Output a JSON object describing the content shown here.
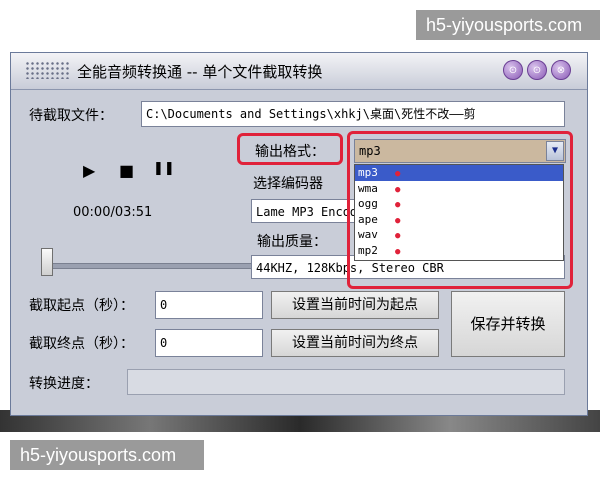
{
  "watermark": {
    "top": "h5-yiyousports.com",
    "bottom": "h5-yiyousports.com"
  },
  "window": {
    "title": "全能音频转换通 -- 单个文件截取转换",
    "title_buttons": [
      "⊙",
      "⊙",
      "⊗"
    ]
  },
  "file": {
    "label": "待截取文件：",
    "path": "C:\\Documents and Settings\\xhkj\\桌面\\死性不改——剪"
  },
  "player": {
    "play": "▶",
    "stop": "■",
    "pause": "❚❚",
    "time": "00:00/03:51",
    "position": 0.0
  },
  "format": {
    "label": "输出格式：",
    "selected": "mp3",
    "options": [
      "mp3",
      "wma",
      "ogg",
      "ape",
      "wav",
      "mp2"
    ]
  },
  "encoder": {
    "label": "选择编码器",
    "value": "Lame MP3 Encoder"
  },
  "quality": {
    "label": "输出质量：",
    "value": "44KHZ, 128Kbps, Stereo CBR"
  },
  "start": {
    "label": "截取起点（秒）：",
    "value": "0",
    "button": "设置当前时间为起点"
  },
  "end": {
    "label": "截取终点（秒）：",
    "value": "0",
    "button": "设置当前时间为终点"
  },
  "save_button": "保存并转换",
  "progress": {
    "label": "转换进度：",
    "value": 0.0
  },
  "colors": {
    "highlight": "#e0223a",
    "selection": "#3a5bc9"
  }
}
